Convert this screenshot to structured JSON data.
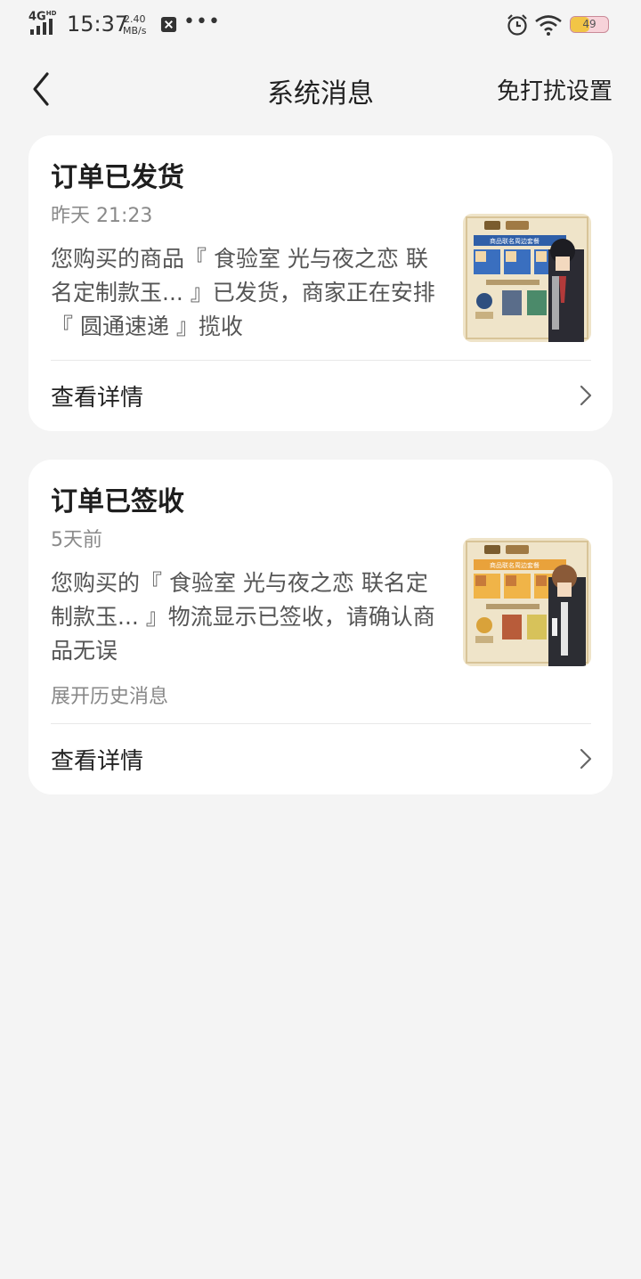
{
  "status_bar": {
    "network": "4G",
    "network_sup": "HD",
    "time": "15:37",
    "speed_value": "2.40",
    "speed_unit": "MB/s",
    "more": "•••",
    "battery_level": "49",
    "battery_fraction": 0.49
  },
  "header": {
    "title": "系统消息",
    "dnd_label": "免打扰设置"
  },
  "messages": [
    {
      "title": "订单已发货",
      "time": "昨天 21:23",
      "body": "您购买的商品『 食验室 光与夜之恋 联名定制款玉... 』已发货，商家正在安排『 圆通速递 』揽收",
      "thumb_banner": "商品联名周边套餐",
      "detail_label": "查看详情"
    },
    {
      "title": "订单已签收",
      "time": "5天前",
      "body": "您购买的『 食验室 光与夜之恋 联名定制款玉... 』物流显示已签收，请确认商品无误",
      "expand_label": "展开历史消息",
      "thumb_banner": "商品联名周边套餐",
      "detail_label": "查看详情"
    }
  ],
  "colors": {
    "background": "#f4f4f4",
    "card": "#ffffff",
    "thumb_frame": "#e9dcc0",
    "thumb_banner_1": "#2f5fa8",
    "thumb_banner_2": "#e9a23b"
  }
}
